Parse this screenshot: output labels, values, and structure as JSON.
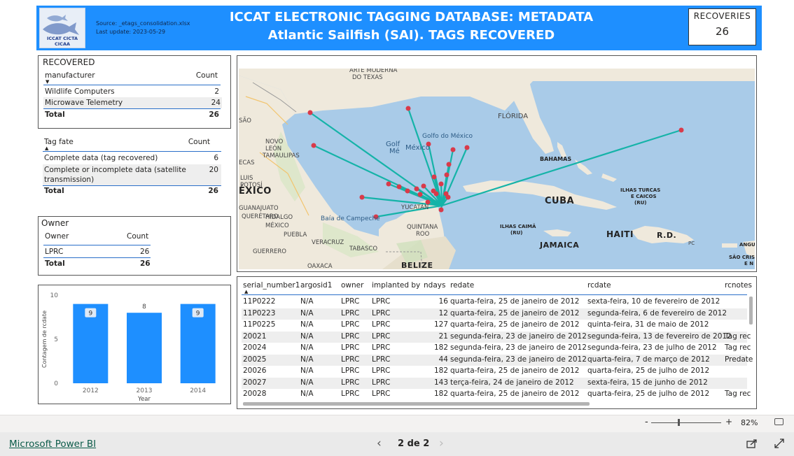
{
  "header": {
    "logo_text": "ICCAT CICTA CICAA",
    "source": "Source: _etags_consolidation.xlsx",
    "last_update": "Last update: 2023-05-29",
    "title_line1": "ICCAT ELECTRONIC TAGGING DATABASE: METADATA",
    "title_line2": "Atlantic Sailfish (SAI). TAGS RECOVERED",
    "card_label": "RECOVERIES",
    "card_value": "26"
  },
  "manufacturer_table": {
    "title": "RECOVERED",
    "col1": "manufacturer",
    "col2": "Count",
    "rows": [
      {
        "name": "Wildlife Computers",
        "count": "2"
      },
      {
        "name": "Microwave Telemetry",
        "count": "24"
      }
    ],
    "total_label": "Total",
    "total": "26"
  },
  "tagfate_table": {
    "col1": "Tag fate",
    "col2": "Count",
    "rows": [
      {
        "name": "Complete data (tag recovered)",
        "count": "6"
      },
      {
        "name": "Complete or incomplete data (satellite",
        "name2": "transmission)",
        "count": "20"
      }
    ],
    "total_label": "Total",
    "total": "26"
  },
  "owner_table": {
    "title": "Owner",
    "col1": "Owner",
    "col2": "Count",
    "rows": [
      {
        "name": "LPRC",
        "count": "26"
      }
    ],
    "total_label": "Total",
    "total": "26"
  },
  "chart_data": {
    "type": "bar",
    "categories": [
      "2012",
      "2013",
      "2014"
    ],
    "values": [
      9,
      8,
      9
    ],
    "data_labels": [
      "9",
      "8",
      "9"
    ],
    "xlabel": "Year",
    "ylabel": "Contagem de rcdate",
    "ylim": [
      0,
      10
    ],
    "yticks": [
      "0",
      "5",
      "10"
    ],
    "color": "#1e8fff"
  },
  "map": {
    "labels": {
      "arte_moderna": "ARTE MODERNA",
      "do_texas": "DO TEXAS",
      "florida": "FLÓRIDA",
      "golfo_mexico": "Golfo do México",
      "golf_me": "Golf",
      "golf_me2": "Mé",
      "mexico_sea": "México",
      "bahamas": "BAHAMAS",
      "cuba": "CUBA",
      "ilhas_turcas": "ILHAS TURCAS",
      "e_caicos": "E CAICOS",
      "ru1": "(RU)",
      "ilhas_caima": "ILHAS CAIMÃ",
      "ru2": "(RU)",
      "haiti": "HAITI",
      "rd": "R.D.",
      "jamaica": "JAMAICA",
      "mexico_country": "ÉXICO",
      "belize": "BELIZE",
      "baia_campeche": "Baía de Campeche",
      "yucatan": "YUCATÁN",
      "quintana": "QUINTANA",
      "roo": "ROO",
      "tabasco": "TABASCO",
      "veracruz": "VERACRUZ",
      "oaxaca": "OAXACA",
      "guerrero": "GUERRERO",
      "puebla": "PUEBLA",
      "hidalgo": "HIDALGO",
      "mexico_state": "MÉXICO",
      "queretaro": "QUERÉTARO",
      "guanajuato": "GUANAJUATO",
      "tamaulipas": "TAMAULIPAS",
      "nuevo": "NOVO",
      "leon": "LEÓN",
      "luis": "LUIS",
      "potosi": "POTOSÍ",
      "ecas": "ECAS",
      "sao_lbl": "SÃO",
      "pc": "PC",
      "angu": "ANGU",
      "sao_cris": "SÃO CRIST",
      "en": "E N"
    },
    "origin_color": "#15b3a8",
    "point_color": "#d93a4a"
  },
  "data_table": {
    "headers": [
      "serial_number1",
      "argosid1",
      "owner",
      "implanted by",
      "ndays",
      "redate",
      "rcdate",
      "rcnotes"
    ],
    "rows": [
      [
        "11P0222",
        "N/A",
        "LPRC",
        "LPRC",
        "16",
        "quarta-feira, 25 de janeiro de 2012",
        "sexta-feira, 10 de fevereiro de 2012",
        ""
      ],
      [
        "11P0223",
        "N/A",
        "LPRC",
        "LPRC",
        "12",
        "quarta-feira, 25 de janeiro de 2012",
        "segunda-feira, 6 de fevereiro de 2012",
        ""
      ],
      [
        "11P0225",
        "N/A",
        "LPRC",
        "LPRC",
        "127",
        "quarta-feira, 25 de janeiro de 2012",
        "quinta-feira, 31 de maio de 2012",
        ""
      ],
      [
        "20021",
        "N/A",
        "LPRC",
        "LPRC",
        "21",
        "segunda-feira, 23 de janeiro de 2012",
        "segunda-feira, 13 de fevereiro de 2012",
        "Tag rec"
      ],
      [
        "20024",
        "N/A",
        "LPRC",
        "LPRC",
        "182",
        "segunda-feira, 23 de janeiro de 2012",
        "segunda-feira, 23 de julho de 2012",
        "Tag rec"
      ],
      [
        "20025",
        "N/A",
        "LPRC",
        "LPRC",
        "44",
        "segunda-feira, 23 de janeiro de 2012",
        "quarta-feira, 7 de março de 2012",
        "Predate"
      ],
      [
        "20026",
        "N/A",
        "LPRC",
        "LPRC",
        "182",
        "quarta-feira, 25 de janeiro de 2012",
        "quarta-feira, 25 de julho de 2012",
        ""
      ],
      [
        "20027",
        "N/A",
        "LPRC",
        "LPRC",
        "143",
        "terça-feira, 24 de janeiro de 2012",
        "sexta-feira, 15 de junho de 2012",
        ""
      ],
      [
        "20028",
        "N/A",
        "LPRC",
        "LPRC",
        "182",
        "quarta-feira, 25 de janeiro de 2012",
        "quarta-feira, 25 de julho de 2012",
        "Tag rec"
      ]
    ]
  },
  "zoom": {
    "minus": "-",
    "plus": "+",
    "level": "82%"
  },
  "footer": {
    "brand": "Microsoft Power BI",
    "page": "2 de 2",
    "prev": "‹",
    "next": "›"
  }
}
